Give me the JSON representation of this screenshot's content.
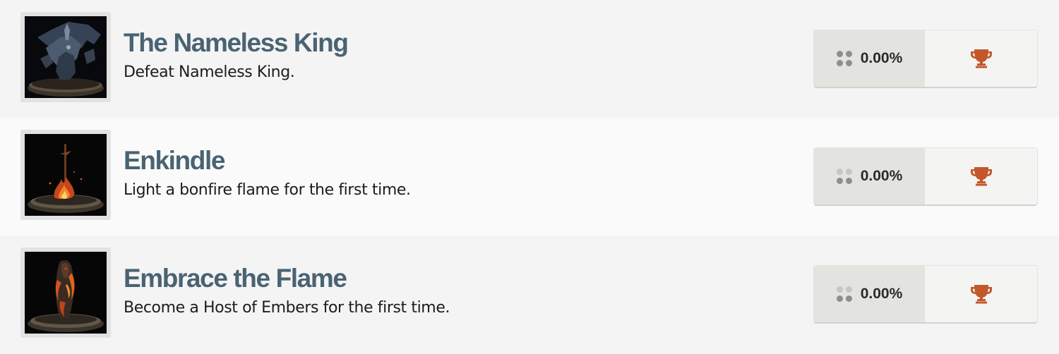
{
  "accent_colors": {
    "title": "#4a6373",
    "trophy_bronze": "#c2582c",
    "rarity_dots": "#8e8e8e"
  },
  "achievements": [
    {
      "title": "The Nameless King",
      "description": "Defeat Nameless King.",
      "percent": "0.00%",
      "image_icon": "nameless-king-icon",
      "trophy_icon": "bronze-trophy-icon"
    },
    {
      "title": "Enkindle",
      "description": "Light a bonfire flame for the first time.",
      "percent": "0.00%",
      "image_icon": "bonfire-icon",
      "trophy_icon": "bronze-trophy-icon"
    },
    {
      "title": "Embrace the Flame",
      "description": "Become a Host of Embers for the first time.",
      "percent": "0.00%",
      "image_icon": "ember-knight-icon",
      "trophy_icon": "bronze-trophy-icon"
    }
  ]
}
